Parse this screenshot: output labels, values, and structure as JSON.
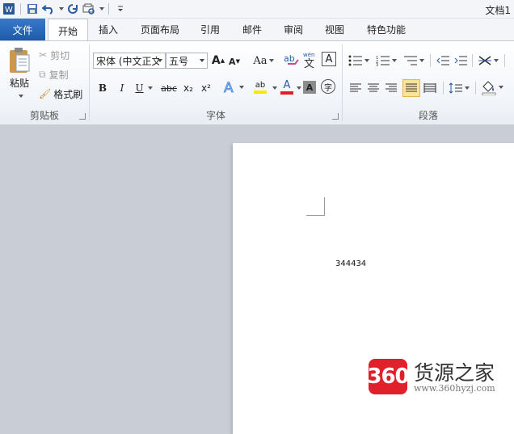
{
  "window": {
    "title": "文档1"
  },
  "tabs": {
    "file": "文件",
    "items": [
      "开始",
      "插入",
      "页面布局",
      "引用",
      "邮件",
      "审阅",
      "视图",
      "特色功能"
    ]
  },
  "clipboard": {
    "paste": "粘贴",
    "cut": "剪切",
    "copy": "复制",
    "format_painter": "格式刷",
    "label": "剪贴板"
  },
  "font": {
    "family": "宋体 (中文正文",
    "size": "五号",
    "label": "字体",
    "change_case": "Aa",
    "grow": "A",
    "shrink": "A",
    "clear_format": "A",
    "phonetic": "wén",
    "char_border": "A",
    "bold": "B",
    "italic": "I",
    "underline": "U",
    "strike": "abc",
    "sub": "x₂",
    "sup": "x²",
    "highlight": "ab",
    "color": "A",
    "shade": "A",
    "enclose": "字"
  },
  "paragraph": {
    "label": "段落"
  },
  "document": {
    "text": "344434"
  },
  "watermark": {
    "logo": "360",
    "name": "货源之家",
    "url": "www.360hyzj.com"
  },
  "colors": {
    "file_tab": "#2b6bbe",
    "accent_red": "#e0202a",
    "highlight_yellow": "#ffe600",
    "font_red": "#e02020"
  }
}
